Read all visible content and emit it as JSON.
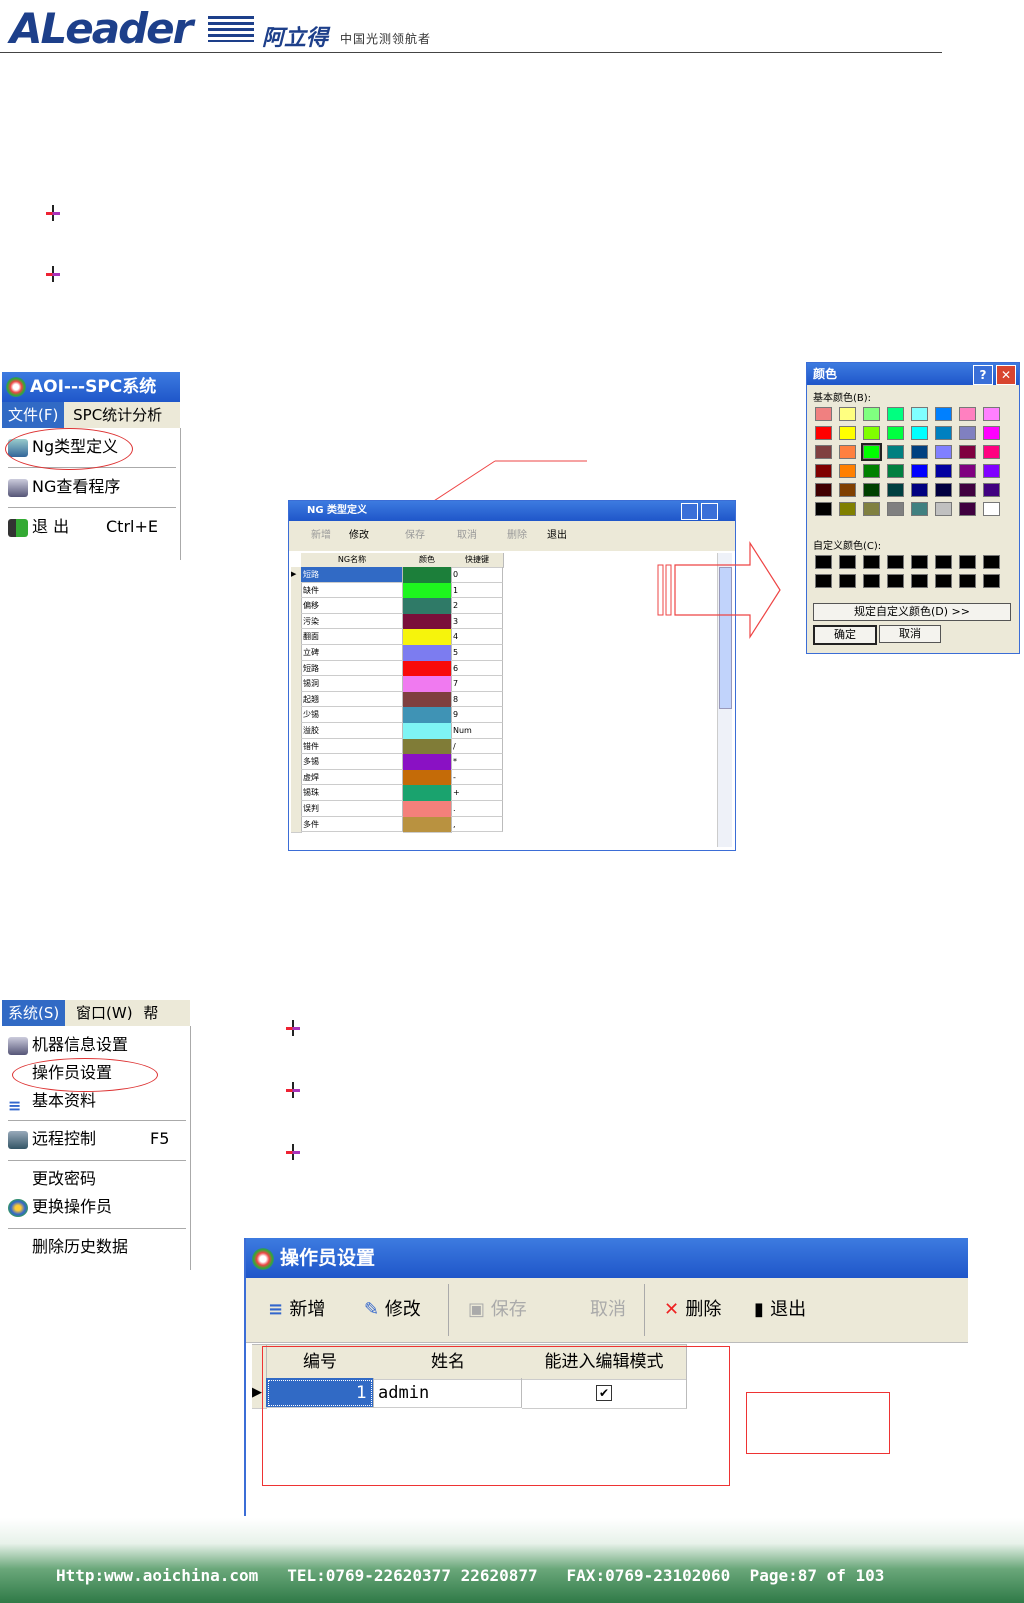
{
  "header": {
    "logo_text": "ALeader",
    "logo_cn": "阿立得",
    "tagline": "中国光测领航者"
  },
  "menu1": {
    "title": "AOI---SPC系统",
    "menubar": [
      "文件(F)",
      "SPC统计分析"
    ],
    "items": [
      "Ng类型定义",
      "NG查看程序",
      "退 出"
    ],
    "shortcut_exit": "Ctrl+E"
  },
  "ng_window": {
    "title": "NG 类型定义",
    "toolbar": [
      "新增",
      "修改",
      "保存",
      "取消",
      "删除",
      "退出"
    ],
    "columns": [
      "NG名称",
      "颜色",
      "快捷键"
    ],
    "rows": [
      {
        "name": "短路",
        "color": "#1c7f3a",
        "key": "0"
      },
      {
        "name": "缺件",
        "color": "#1ef51e",
        "key": "1"
      },
      {
        "name": "偏移",
        "color": "#2f7a67",
        "key": "2"
      },
      {
        "name": "污染",
        "color": "#7a0f3a",
        "key": "3"
      },
      {
        "name": "翻面",
        "color": "#f6f40c",
        "key": "4"
      },
      {
        "name": "立碑",
        "color": "#7c7cf0",
        "key": "5"
      },
      {
        "name": "短路",
        "color": "#f80a0a",
        "key": "6"
      },
      {
        "name": "锡洞",
        "color": "#f07af0",
        "key": "7"
      },
      {
        "name": "起翘",
        "color": "#7f3f3f",
        "key": "8"
      },
      {
        "name": "少锡",
        "color": "#3f93b5",
        "key": "9"
      },
      {
        "name": "溢胶",
        "color": "#7ef4f4",
        "key": "Num"
      },
      {
        "name": "错件",
        "color": "#807c37",
        "key": "/"
      },
      {
        "name": "多锡",
        "color": "#8a11c4",
        "key": "*"
      },
      {
        "name": "虚焊",
        "color": "#c46b08",
        "key": "-"
      },
      {
        "name": "锡珠",
        "color": "#1aa36e",
        "key": "+"
      },
      {
        "name": "误判",
        "color": "#f4807b",
        "key": "."
      },
      {
        "name": "多件",
        "color": "#b99240",
        "key": ","
      }
    ]
  },
  "color_dialog": {
    "title": "颜色",
    "basic_label": "基本颜色(B):",
    "custom_label": "自定义颜色(C):",
    "define_button": "规定自定义颜色(D) >>",
    "ok": "确定",
    "cancel": "取消",
    "basic_colors": [
      "#f08080",
      "#ffff80",
      "#80ff80",
      "#00ff80",
      "#80ffff",
      "#0080ff",
      "#ff80c0",
      "#ff80ff",
      "#ff0000",
      "#ffff00",
      "#80ff00",
      "#00ff40",
      "#00ffff",
      "#0080c0",
      "#8080c0",
      "#ff00ff",
      "#804040",
      "#ff8040",
      "#00ff00",
      "#008080",
      "#004080",
      "#8080ff",
      "#800040",
      "#ff0080",
      "#800000",
      "#ff8000",
      "#008000",
      "#008040",
      "#0000ff",
      "#0000a0",
      "#800080",
      "#8000ff",
      "#400000",
      "#804000",
      "#004000",
      "#004040",
      "#000080",
      "#000040",
      "#400040",
      "#400080",
      "#000000",
      "#808000",
      "#808040",
      "#808080",
      "#408080",
      "#c0c0c0",
      "#400040",
      "#ffffff"
    ]
  },
  "menu2": {
    "menubar": [
      "系统(S)",
      "窗口(W)",
      "帮"
    ],
    "items": [
      "机器信息设置",
      "操作员设置",
      "基本资料",
      "远程控制",
      "更改密码",
      "更换操作员",
      "删除历史数据"
    ],
    "shortcut_remote": "F5"
  },
  "operator_window": {
    "title": "操作员设置",
    "toolbar": [
      "新增",
      "修改",
      "保存",
      "取消",
      "删除",
      "退出"
    ],
    "columns": [
      "编号",
      "姓名",
      "能进入编辑模式"
    ],
    "rows": [
      {
        "id": "1",
        "name": "admin",
        "edit": "✔"
      }
    ]
  },
  "footer": {
    "text": "Http:www.aoichina.com   TEL:0769-22620377 22620877   FAX:0769-23102060  Page:87 of 103"
  }
}
